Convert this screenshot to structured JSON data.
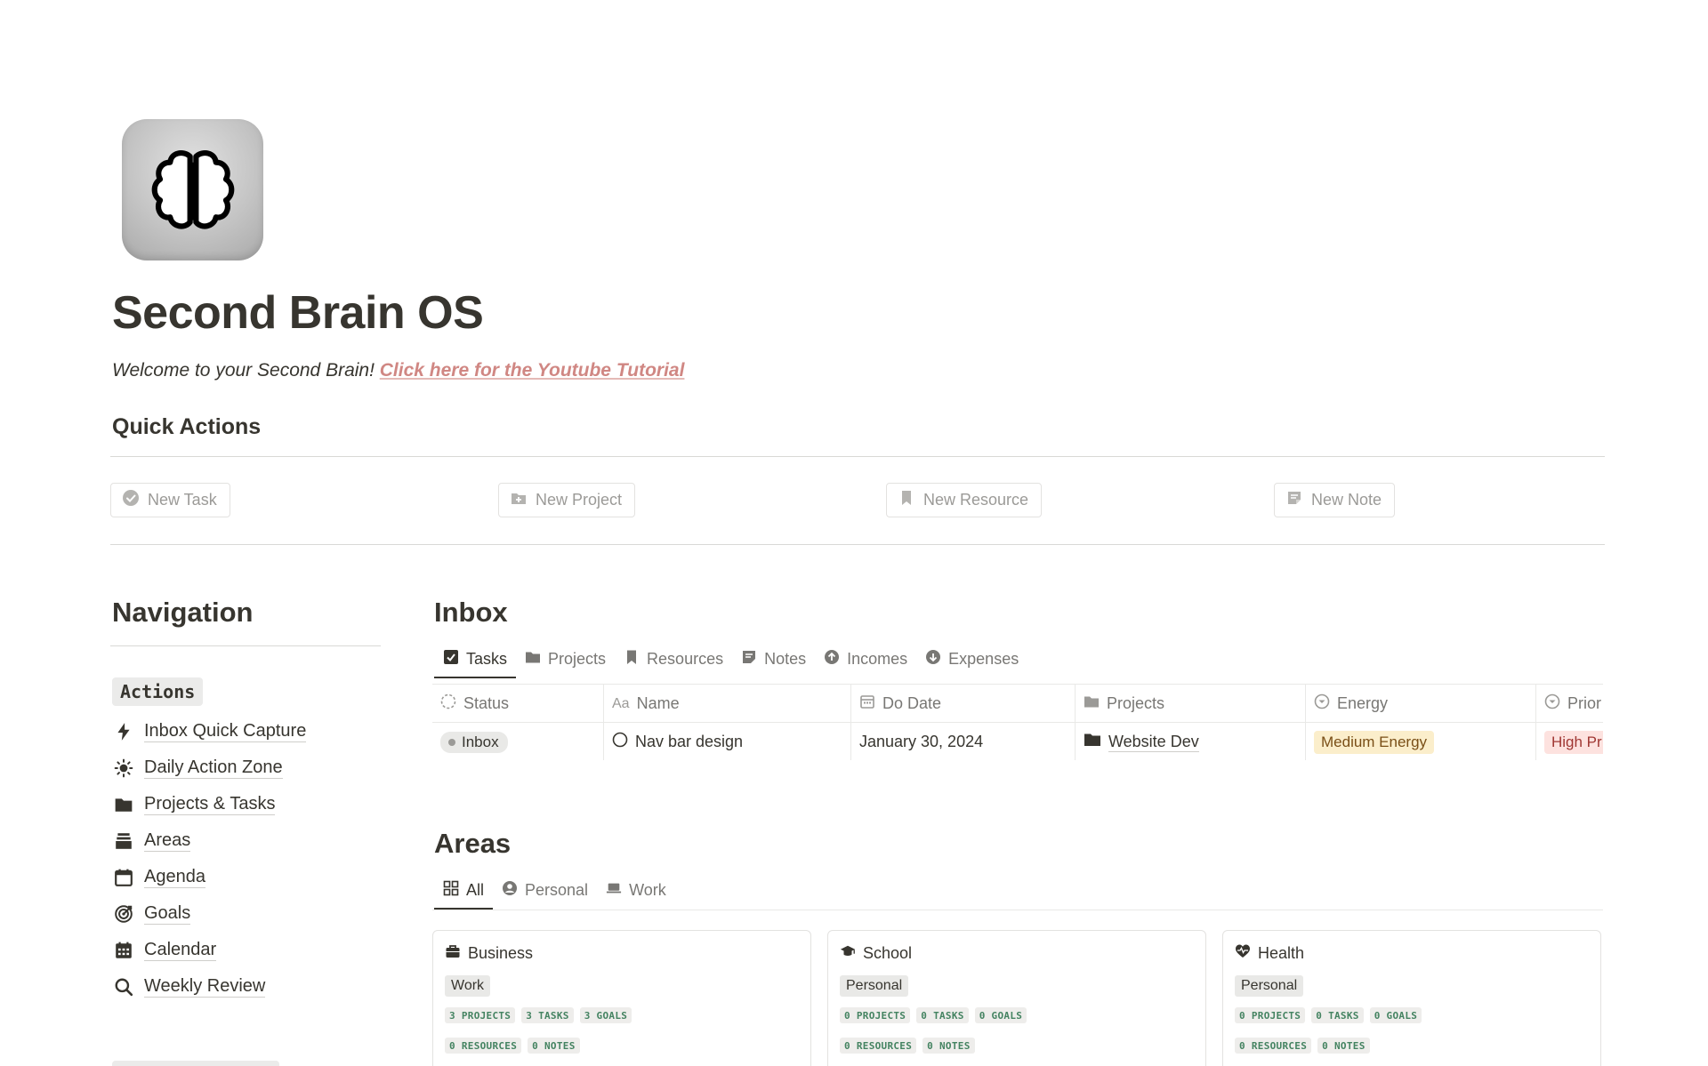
{
  "header": {
    "title": "Second Brain OS",
    "welcome_text": "Welcome to your Second Brain! ",
    "tutorial_link": "Click here for the Youtube Tutorial",
    "icon": "brain-icon"
  },
  "quick_actions": {
    "title": "Quick Actions",
    "buttons": [
      {
        "label": "New Task",
        "icon": "check-circle-icon"
      },
      {
        "label": "New Project",
        "icon": "folder-plus-icon"
      },
      {
        "label": "New Resource",
        "icon": "bookmark-icon"
      },
      {
        "label": "New Note",
        "icon": "note-icon"
      }
    ]
  },
  "navigation": {
    "title": "Navigation",
    "section_label": "Actions",
    "items": [
      {
        "label": "Inbox Quick Capture",
        "icon": "bolt-icon"
      },
      {
        "label": "Daily Action Zone",
        "icon": "sun-icon"
      },
      {
        "label": "Projects & Tasks",
        "icon": "folder-icon"
      },
      {
        "label": "Areas",
        "icon": "stack-icon"
      },
      {
        "label": "Agenda",
        "icon": "calendar-icon"
      },
      {
        "label": "Goals",
        "icon": "target-icon"
      },
      {
        "label": "Calendar",
        "icon": "calendar-grid-icon"
      },
      {
        "label": "Weekly Review",
        "icon": "search-icon"
      }
    ]
  },
  "inbox": {
    "title": "Inbox",
    "tabs": [
      {
        "label": "Tasks",
        "icon": "checkbox-icon",
        "active": true
      },
      {
        "label": "Projects",
        "icon": "folder-icon",
        "active": false
      },
      {
        "label": "Resources",
        "icon": "bookmark-icon",
        "active": false
      },
      {
        "label": "Notes",
        "icon": "note-icon",
        "active": false
      },
      {
        "label": "Incomes",
        "icon": "arrow-up-circle-icon",
        "active": false
      },
      {
        "label": "Expenses",
        "icon": "arrow-down-circle-icon",
        "active": false
      }
    ],
    "columns": [
      {
        "label": "Status",
        "icon": "status-icon"
      },
      {
        "label": "Name",
        "icon": "text-icon"
      },
      {
        "label": "Do Date",
        "icon": "calendar-icon"
      },
      {
        "label": "Projects",
        "icon": "folder-icon"
      },
      {
        "label": "Energy",
        "icon": "select-icon"
      },
      {
        "label": "Prior",
        "icon": "select-icon"
      }
    ],
    "rows": [
      {
        "status": "Inbox",
        "name": "Nav bar design",
        "do_date": "January 30, 2024",
        "project": "Website Dev",
        "energy": "Medium Energy",
        "priority": "High Pr"
      }
    ]
  },
  "areas": {
    "title": "Areas",
    "tabs": [
      {
        "label": "All",
        "icon": "grid-icon",
        "active": true
      },
      {
        "label": "Personal",
        "icon": "user-circle-icon",
        "active": false
      },
      {
        "label": "Work",
        "icon": "laptop-icon",
        "active": false
      }
    ],
    "cards": [
      {
        "name": "Business",
        "icon": "briefcase-icon",
        "tag": "Work",
        "projects": "3 PROJECTS",
        "tasks": "3 TASKS",
        "goals": "3 GOALS",
        "resources": "0 RESOURCES",
        "notes": "0 NOTES"
      },
      {
        "name": "School",
        "icon": "graduation-cap-icon",
        "tag": "Personal",
        "projects": "0 PROJECTS",
        "tasks": "0 TASKS",
        "goals": "0 GOALS",
        "resources": "0 RESOURCES",
        "notes": "0 NOTES"
      },
      {
        "name": "Health",
        "icon": "heart-pulse-icon",
        "tag": "Personal",
        "projects": "0 PROJECTS",
        "tasks": "0 TASKS",
        "goals": "0 GOALS",
        "resources": "0 RESOURCES",
        "notes": "0 NOTES"
      }
    ]
  }
}
